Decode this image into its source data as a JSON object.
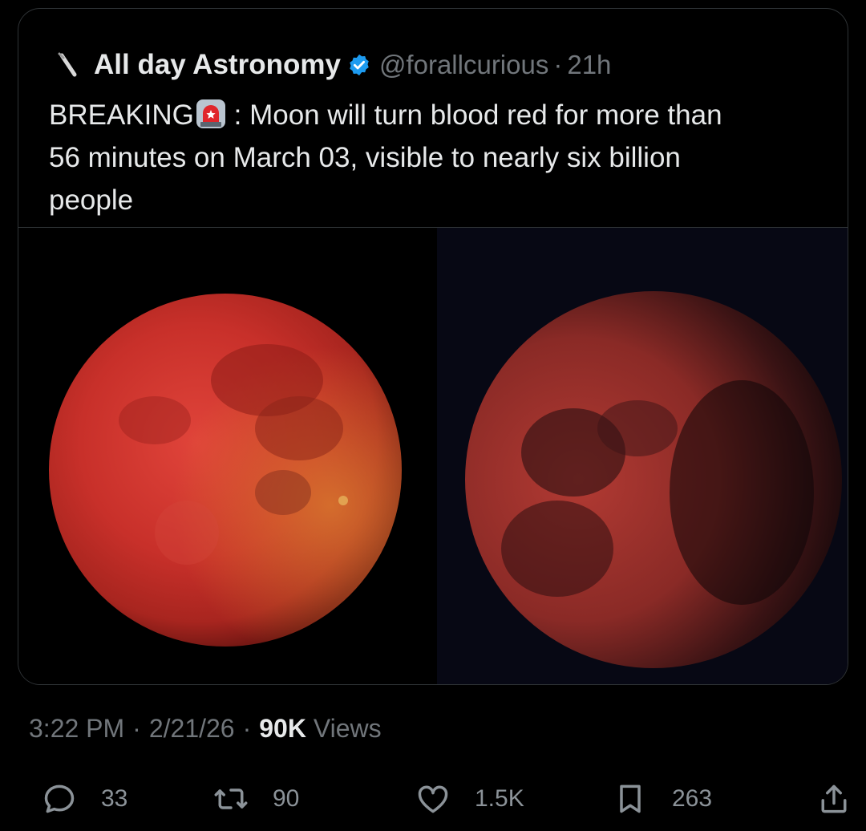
{
  "quoted_tweet": {
    "display_name": "All day Astronomy",
    "handle": "@forallcurious",
    "dot": "·",
    "time": "21h",
    "verified": true,
    "text_line1_pre": "BREAKING",
    "text_line1_post": ": Moon will turn blood red for more than",
    "text_line2": "56 minutes on March 03, visible to nearly six billion",
    "text_line3": "people",
    "emoji_icon": "rotating-light-icon",
    "media": [
      {
        "name": "blood-moon-photo-1",
        "icon": "red-moon"
      },
      {
        "name": "blood-moon-photo-2",
        "icon": "red-moon-partial"
      }
    ]
  },
  "meta": {
    "time": "3:22 PM",
    "dot": "·",
    "date": "2/21/26",
    "views_count": "90K",
    "views_label": "Views"
  },
  "actions": {
    "replies": "33",
    "reposts": "90",
    "likes": "1.5K",
    "bookmarks": "263"
  },
  "colors": {
    "background": "#000000",
    "text_primary": "#e7e9ea",
    "text_secondary": "#71767b",
    "border": "#2f3336",
    "verified": "#1d9bf0"
  }
}
